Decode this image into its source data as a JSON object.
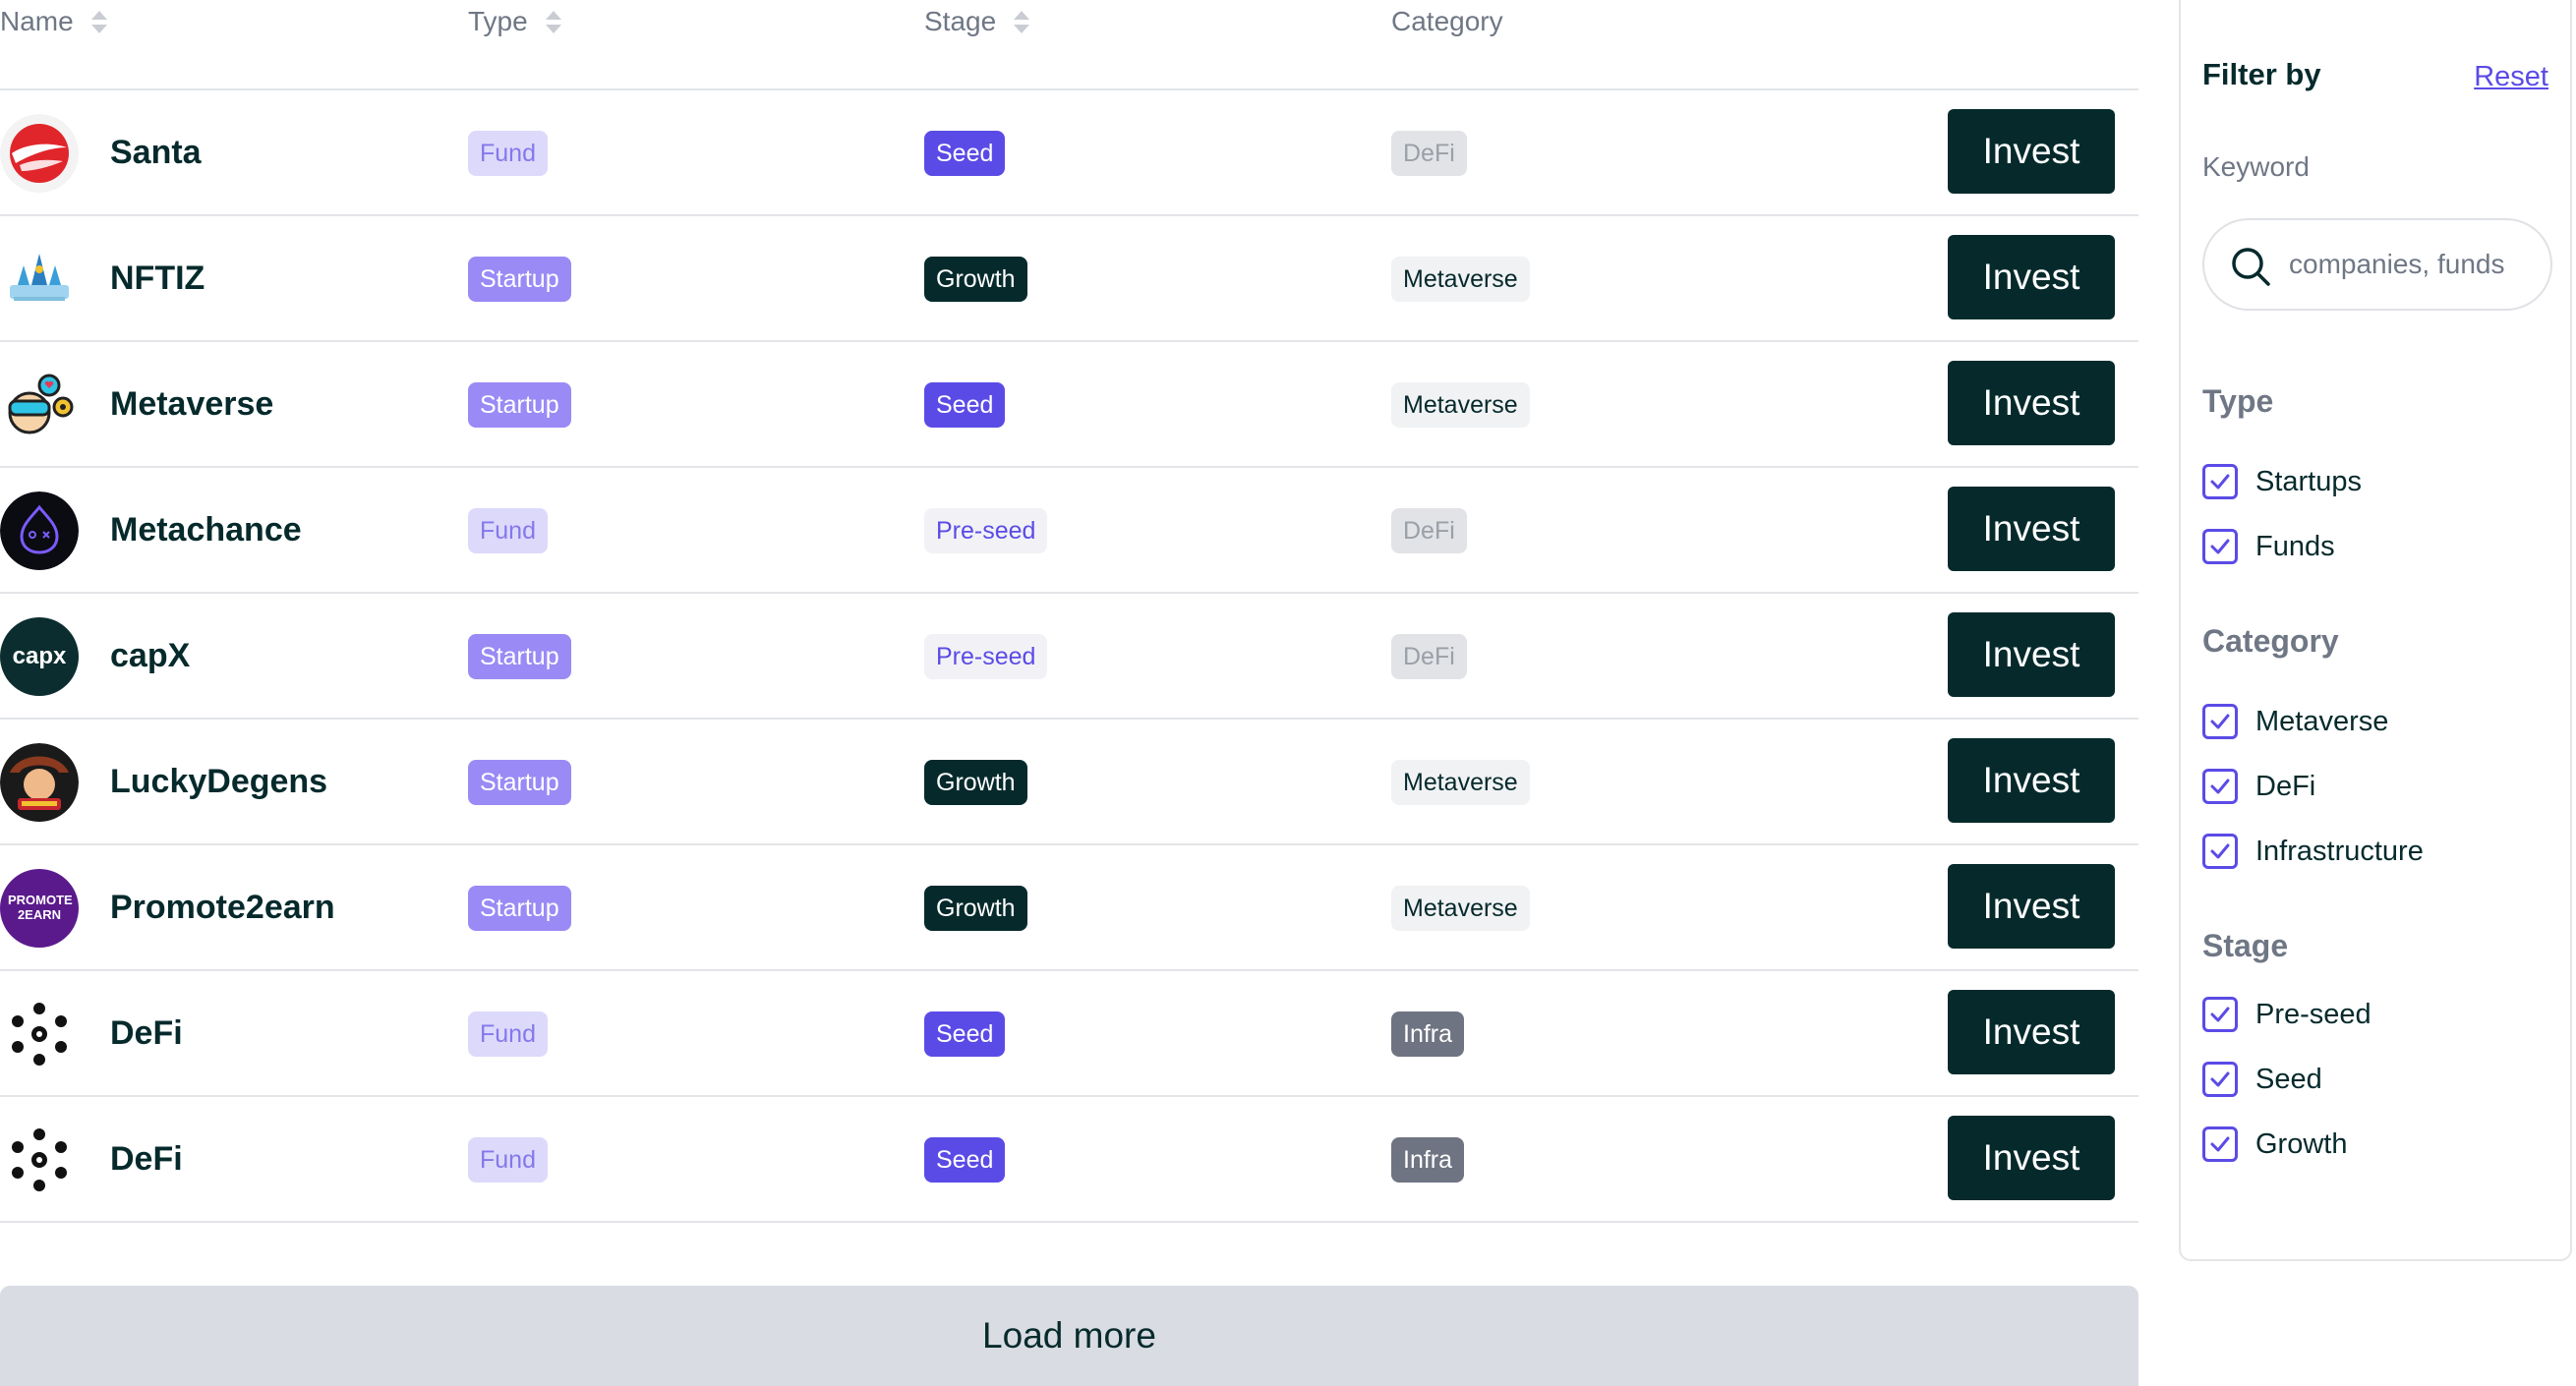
{
  "table": {
    "headers": {
      "name": "Name",
      "type": "Type",
      "stage": "Stage",
      "category": "Category"
    },
    "rows": [
      {
        "name": "Santa",
        "logo": "santa-logo",
        "type": "Fund",
        "stage": "Seed",
        "category": "DeFi",
        "action": "Invest"
      },
      {
        "name": "NFTIZ",
        "logo": "nftiz-logo",
        "type": "Startup",
        "stage": "Growth",
        "category": "Metaverse",
        "action": "Invest"
      },
      {
        "name": "Metaverse",
        "logo": "metaverse-logo",
        "type": "Startup",
        "stage": "Seed",
        "category": "Metaverse",
        "action": "Invest"
      },
      {
        "name": "Metachance",
        "logo": "metachance-logo",
        "type": "Fund",
        "stage": "Pre-seed",
        "category": "DeFi",
        "action": "Invest"
      },
      {
        "name": "capX",
        "logo": "capx-logo",
        "logo_text": "capx",
        "type": "Startup",
        "stage": "Pre-seed",
        "category": "DeFi",
        "action": "Invest"
      },
      {
        "name": "LuckyDegens",
        "logo": "luckydegens-logo",
        "type": "Startup",
        "stage": "Growth",
        "category": "Metaverse",
        "action": "Invest"
      },
      {
        "name": "Promote2earn",
        "logo": "promote2earn-logo",
        "logo_text": "PROMOTE 2EARN",
        "type": "Startup",
        "stage": "Growth",
        "category": "Metaverse",
        "action": "Invest"
      },
      {
        "name": "DeFi",
        "logo": "defi-logo",
        "type": "Fund",
        "stage": "Seed",
        "category": "Infra",
        "action": "Invest"
      },
      {
        "name": "DeFi",
        "logo": "defi-logo",
        "type": "Fund",
        "stage": "Seed",
        "category": "Infra",
        "action": "Invest"
      }
    ],
    "load_more": "Load more"
  },
  "filter": {
    "title": "Filter by",
    "reset": "Reset",
    "keyword_label": "Keyword",
    "search_placeholder": "companies, funds",
    "search_value": "",
    "sections": [
      {
        "title": "Type",
        "options": [
          {
            "label": "Startups",
            "checked": true
          },
          {
            "label": "Funds",
            "checked": true
          }
        ]
      },
      {
        "title": "Category",
        "options": [
          {
            "label": "Metaverse",
            "checked": true
          },
          {
            "label": "DeFi",
            "checked": true
          },
          {
            "label": "Infrastructure",
            "checked": true
          }
        ]
      },
      {
        "title": "Stage",
        "options": [
          {
            "label": "Pre-seed",
            "checked": true
          },
          {
            "label": "Seed",
            "checked": true
          },
          {
            "label": "Growth",
            "checked": true
          }
        ]
      }
    ]
  },
  "colors": {
    "primary_dark": "#062a2c",
    "accent_purple": "#5b4be6",
    "startup_tag": "#9a8af5",
    "fund_tag_bg": "#ddd9fb",
    "infra_tag": "#6f7482",
    "load_more_bg": "#d9dce2"
  }
}
